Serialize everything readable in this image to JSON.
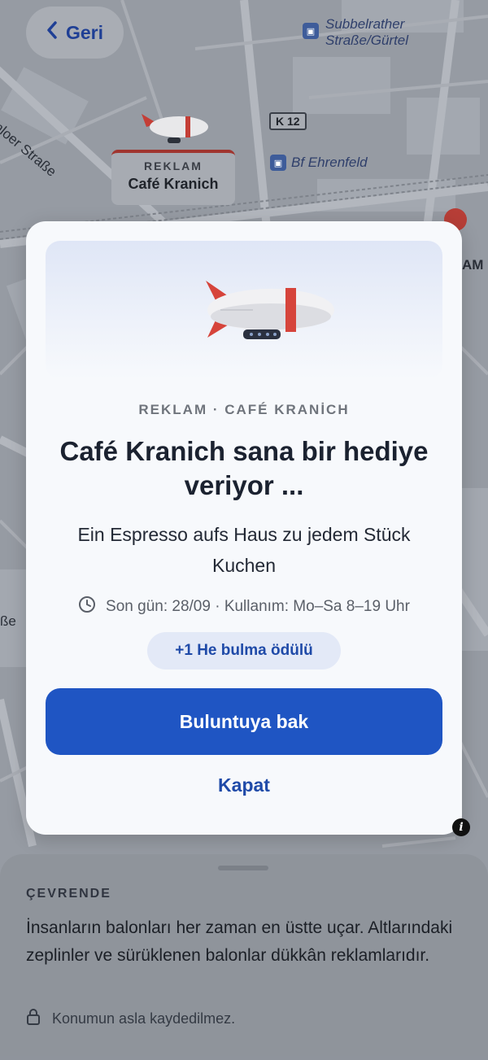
{
  "nav": {
    "back_label": "Geri"
  },
  "map": {
    "labels": {
      "station_top": "Subbelrather\nStraße/Gürtel",
      "station_mid": "Bf Ehrenfeld",
      "road_badge": "K 12",
      "street_left": "enloer Straße",
      "edge_right": "AM",
      "edge_left": "ße"
    },
    "ad_pin": {
      "tag": "REKLAM",
      "name": "Café Kranich"
    }
  },
  "modal": {
    "eyebrow": "REKLAM · CAFÉ KRANİCH",
    "title": "Café Kranich sana bir hediye veriyor ...",
    "subtitle": "Ein Espresso aufs Haus zu jedem Stück Kuchen",
    "meta": "Son gün: 28/09 · Kullanım: Mo–Sa 8–19 Uhr",
    "reward": "+1 He bulma ödülü",
    "primary_label": "Buluntuya bak",
    "close_label": "Kapat"
  },
  "sheet": {
    "eyebrow": "ÇEVRENDE",
    "body": "İnsanların balonları her zaman en üstte uçar. Altlarındaki zeplinler ve sürüklenen balonlar dükkân reklamlarıdır.",
    "privacy": "Konumun asla kaydedilmez."
  },
  "colors": {
    "accent": "#1f55c3",
    "reward_bg": "#e3e9f7",
    "zeppelin_stripe": "#d6443b"
  },
  "icons": [
    "chevron-left-icon",
    "bus-stop-icon",
    "zeppelin-icon",
    "clock-icon",
    "info-icon",
    "lock-icon"
  ]
}
